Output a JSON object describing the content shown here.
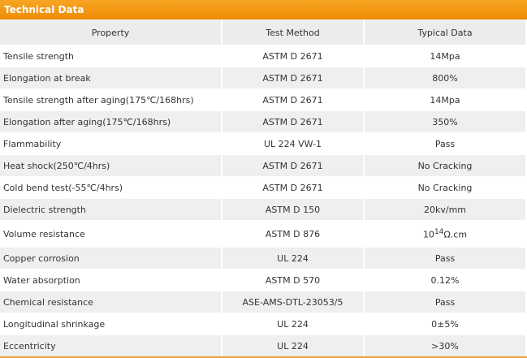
{
  "header": {
    "title": "Technical Data"
  },
  "table": {
    "columns": [
      "Property",
      "Test Method",
      "Typical Data"
    ],
    "rows": [
      [
        "Tensile strength",
        "ASTM D 2671",
        "14Mpa"
      ],
      [
        "Elongation at break",
        "ASTM D 2671",
        "800%"
      ],
      [
        "Tensile strength after aging(175℃/168hrs)",
        "ASTM D 2671",
        "14Mpa"
      ],
      [
        "Elongation after aging(175℃/168hrs)",
        "ASTM D 2671",
        "350%"
      ],
      [
        "Flammability",
        "UL 224 VW-1",
        "Pass"
      ],
      [
        "Heat shock(250℃/4hrs)",
        "ASTM D 2671",
        "No Cracking"
      ],
      [
        "Cold bend test(-55℃/4hrs)",
        "ASTM D 2671",
        "No Cracking"
      ],
      [
        "Dielectric strength",
        "ASTM D 150",
        "20kv/mm"
      ],
      [
        "Volume resistance",
        "ASTM D 876",
        "10"
      ],
      [
        "Copper corrosion",
        "UL 224",
        "Pass"
      ],
      [
        "Water absorption",
        "ASTM D 570",
        "0.12%"
      ],
      [
        "Chemical resistance",
        "ASE-AMS-DTL-23053/5",
        "Pass"
      ],
      [
        "Longitudinal shrinkage",
        "UL 224",
        "0±5%"
      ],
      [
        "Eccentricity",
        "UL 224",
        ">30%"
      ]
    ],
    "volume_exponent": "14",
    "volume_unit": "Ω.cm"
  }
}
